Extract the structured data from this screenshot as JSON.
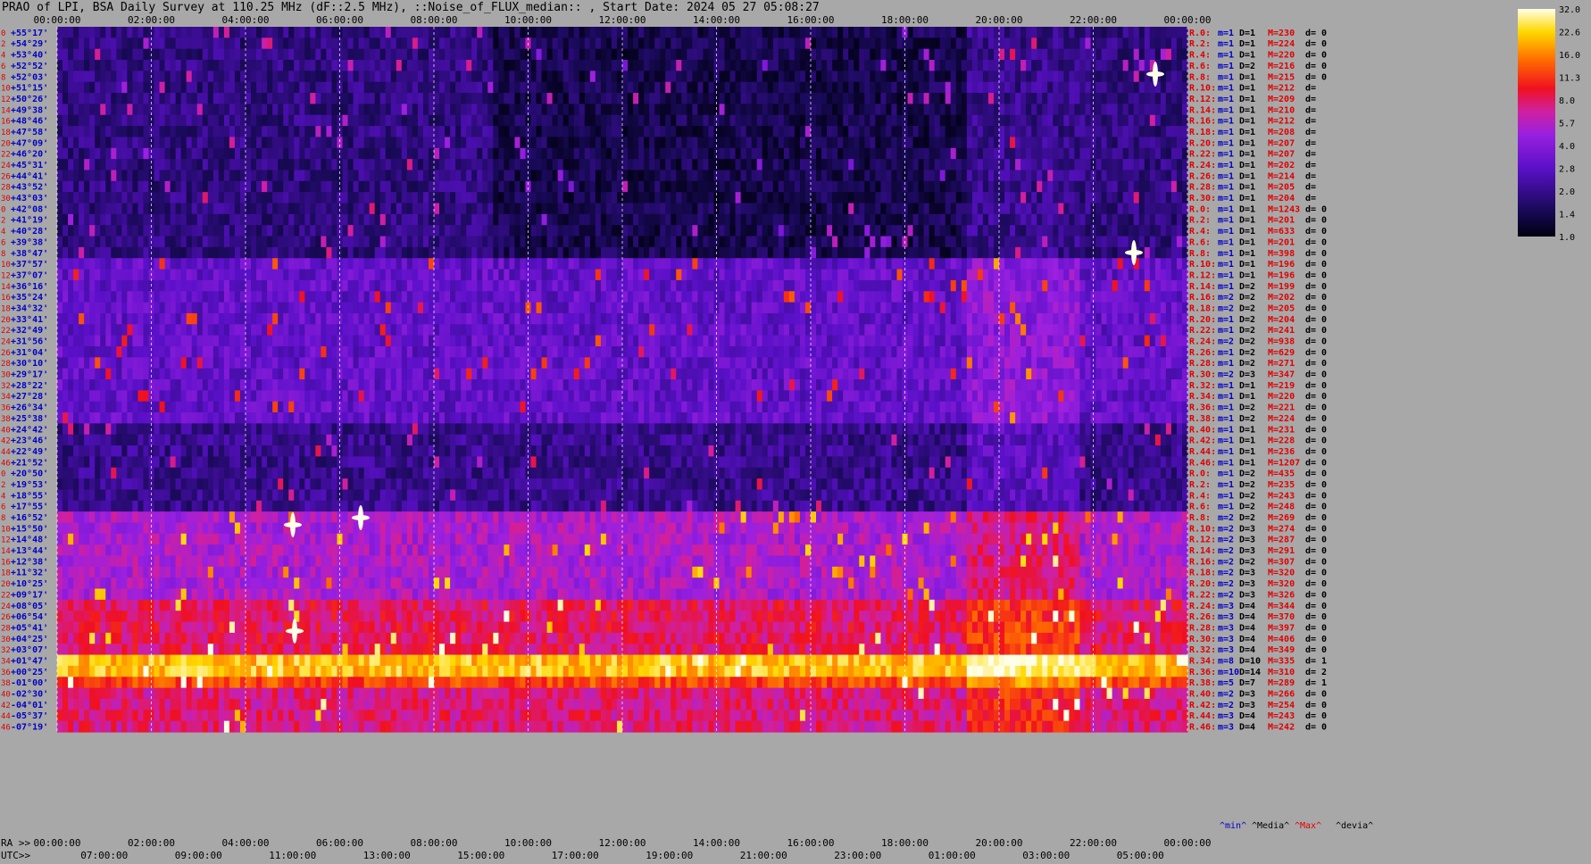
{
  "title": "PRAO of LPI, BSA Daily Survey at 110.25 MHz (dF::2.5 MHz), ::Noise_of_FLUX_median:: , Start Date: 2024 05 27 05:08:27",
  "chart_data": {
    "type": "heatmap",
    "title": "PRAO of LPI, BSA Daily Survey at 110.25 MHz (dF::2.5 MHz), ::Noise_of_FLUX_median:: , Start Date: 2024 05 27 05:08:27",
    "xaxis_ra_label": "RA >>",
    "xaxis_utc_label": "UTC>>",
    "ra_ticks": [
      "00:00:00",
      "02:00:00",
      "04:00:00",
      "06:00:00",
      "08:00:00",
      "10:00:00",
      "12:00:00",
      "14:00:00",
      "16:00:00",
      "18:00:00",
      "20:00:00",
      "22:00:00",
      "00:00:00"
    ],
    "utc_ticks": [
      "07:00:00",
      "09:00:00",
      "11:00:00",
      "13:00:00",
      "15:00:00",
      "17:00:00",
      "19:00:00",
      "21:00:00",
      "23:00:00",
      "01:00:00",
      "03:00:00",
      "05:00:00"
    ],
    "dec_labels": [
      "+55°17'",
      "+54°29'",
      "+53°40'",
      "+52°52'",
      "+52°03'",
      "+51°15'",
      "+50°26'",
      "+49°38'",
      "+48°46'",
      "+47°58'",
      "+47°09'",
      "+46°20'",
      "+45°31'",
      "+44°41'",
      "+43°52'",
      "+43°03'",
      "+42°08'",
      "+41°19'",
      "+40°28'",
      "+39°38'",
      "+38°47'",
      "+37°57'",
      "+37°07'",
      "+36°16'",
      "+35°24'",
      "+34°32'",
      "+33°41'",
      "+32°49'",
      "+31°56'",
      "+31°04'",
      "+30°10'",
      "+29°17'",
      "+28°22'",
      "+27°28'",
      "+26°34'",
      "+25°38'",
      "+24°42'",
      "+23°46'",
      "+22°49'",
      "+21°52'",
      "+20°50'",
      "+19°53'",
      "+18°55'",
      "+17°55'",
      "+16°52'",
      "+15°50'",
      "+14°48'",
      "+13°44'",
      "+12°38'",
      "+11°32'",
      "+10°25'",
      "+09°17'",
      "+08°05'",
      "+06°54'",
      "+05°41'",
      "+04°25'",
      "+03°07'",
      "+01°47'",
      "+00°25'",
      "-01°00'",
      "-02°30'",
      "-04°01'",
      "-05°37'",
      "-07°19'"
    ],
    "row_index_labels": [
      "0",
      "2",
      "4",
      "6",
      "8",
      "10",
      "12",
      "14",
      "16",
      "18",
      "20",
      "22",
      "24",
      "26",
      "28",
      "30",
      "0",
      "2",
      "4",
      "6",
      "8",
      "10",
      "12",
      "14",
      "16",
      "18",
      "20",
      "22",
      "24",
      "26",
      "28",
      "30",
      "32",
      "34",
      "36",
      "38",
      "40",
      "42",
      "44",
      "46",
      "0",
      "2",
      "4",
      "6",
      "8",
      "10",
      "12",
      "14",
      "16",
      "18",
      "20",
      "22",
      "24",
      "26",
      "28",
      "30",
      "32",
      "34",
      "36",
      "38",
      "40",
      "42",
      "44",
      "46"
    ],
    "stats_rows": [
      {
        "r": "R.0:",
        "m": "m=1",
        "d": "D=1",
        "M": "M=230",
        "dv": "d= 0"
      },
      {
        "r": "R.2:",
        "m": "m=1",
        "d": "D=1",
        "M": "M=224",
        "dv": "d= 0"
      },
      {
        "r": "R.4:",
        "m": "m=1",
        "d": "D=1",
        "M": "M=220",
        "dv": "d= 0"
      },
      {
        "r": "R.6:",
        "m": "m=1",
        "d": "D=2",
        "M": "M=216",
        "dv": "d= 0"
      },
      {
        "r": "R.8:",
        "m": "m=1",
        "d": "D=1",
        "M": "M=215",
        "dv": "d= 0"
      },
      {
        "r": "R.10:",
        "m": "m=1",
        "d": "D=1",
        "M": "M=212",
        "dv": "d="
      },
      {
        "r": "R.12:",
        "m": "m=1",
        "d": "D=1",
        "M": "M=209",
        "dv": "d="
      },
      {
        "r": "R.14:",
        "m": "m=1",
        "d": "D=1",
        "M": "M=210",
        "dv": "d="
      },
      {
        "r": "R.16:",
        "m": "m=1",
        "d": "D=1",
        "M": "M=212",
        "dv": "d="
      },
      {
        "r": "R.18:",
        "m": "m=1",
        "d": "D=1",
        "M": "M=208",
        "dv": "d="
      },
      {
        "r": "R.20:",
        "m": "m=1",
        "d": "D=1",
        "M": "M=207",
        "dv": "d="
      },
      {
        "r": "R.22:",
        "m": "m=1",
        "d": "D=1",
        "M": "M=207",
        "dv": "d="
      },
      {
        "r": "R.24:",
        "m": "m=1",
        "d": "D=1",
        "M": "M=202",
        "dv": "d="
      },
      {
        "r": "R.26:",
        "m": "m=1",
        "d": "D=1",
        "M": "M=214",
        "dv": "d="
      },
      {
        "r": "R.28:",
        "m": "m=1",
        "d": "D=1",
        "M": "M=205",
        "dv": "d="
      },
      {
        "r": "R.30:",
        "m": "m=1",
        "d": "D=1",
        "M": "M=204",
        "dv": "d="
      },
      {
        "r": "R.0:",
        "m": "m=1",
        "d": "D=1",
        "M": "M=1243",
        "dv": "d= 0"
      },
      {
        "r": "R.2:",
        "m": "m=1",
        "d": "D=1",
        "M": "M=201",
        "dv": "d= 0"
      },
      {
        "r": "R.4:",
        "m": "m=1",
        "d": "D=1",
        "M": "M=633",
        "dv": "d= 0"
      },
      {
        "r": "R.6:",
        "m": "m=1",
        "d": "D=1",
        "M": "M=201",
        "dv": "d= 0"
      },
      {
        "r": "R.8:",
        "m": "m=1",
        "d": "D=1",
        "M": "M=398",
        "dv": "d= 0"
      },
      {
        "r": "R.10:",
        "m": "m=1",
        "d": "D=1",
        "M": "M=196",
        "dv": "d= 0"
      },
      {
        "r": "R.12:",
        "m": "m=1",
        "d": "D=1",
        "M": "M=196",
        "dv": "d= 0"
      },
      {
        "r": "R.14:",
        "m": "m=1",
        "d": "D=2",
        "M": "M=199",
        "dv": "d= 0"
      },
      {
        "r": "R.16:",
        "m": "m=2",
        "d": "D=2",
        "M": "M=202",
        "dv": "d= 0"
      },
      {
        "r": "R.18:",
        "m": "m=2",
        "d": "D=2",
        "M": "M=205",
        "dv": "d= 0"
      },
      {
        "r": "R.20:",
        "m": "m=1",
        "d": "D=2",
        "M": "M=204",
        "dv": "d= 0"
      },
      {
        "r": "R.22:",
        "m": "m=1",
        "d": "D=2",
        "M": "M=241",
        "dv": "d= 0"
      },
      {
        "r": "R.24:",
        "m": "m=2",
        "d": "D=2",
        "M": "M=938",
        "dv": "d= 0"
      },
      {
        "r": "R.26:",
        "m": "m=1",
        "d": "D=2",
        "M": "M=629",
        "dv": "d= 0"
      },
      {
        "r": "R.28:",
        "m": "m=1",
        "d": "D=2",
        "M": "M=271",
        "dv": "d= 0"
      },
      {
        "r": "R.30:",
        "m": "m=2",
        "d": "D=3",
        "M": "M=347",
        "dv": "d= 0"
      },
      {
        "r": "R.32:",
        "m": "m=1",
        "d": "D=1",
        "M": "M=219",
        "dv": "d= 0"
      },
      {
        "r": "R.34:",
        "m": "m=1",
        "d": "D=1",
        "M": "M=220",
        "dv": "d= 0"
      },
      {
        "r": "R.36:",
        "m": "m=1",
        "d": "D=2",
        "M": "M=221",
        "dv": "d= 0"
      },
      {
        "r": "R.38:",
        "m": "m=1",
        "d": "D=2",
        "M": "M=224",
        "dv": "d= 0"
      },
      {
        "r": "R.40:",
        "m": "m=1",
        "d": "D=1",
        "M": "M=231",
        "dv": "d= 0"
      },
      {
        "r": "R.42:",
        "m": "m=1",
        "d": "D=1",
        "M": "M=228",
        "dv": "d= 0"
      },
      {
        "r": "R.44:",
        "m": "m=1",
        "d": "D=1",
        "M": "M=236",
        "dv": "d= 0"
      },
      {
        "r": "R.46:",
        "m": "m=1",
        "d": "D=1",
        "M": "M=1207",
        "dv": "d= 0"
      },
      {
        "r": "R.0:",
        "m": "m=1",
        "d": "D=2",
        "M": "M=435",
        "dv": "d= 0"
      },
      {
        "r": "R.2:",
        "m": "m=1",
        "d": "D=2",
        "M": "M=235",
        "dv": "d= 0"
      },
      {
        "r": "R.4:",
        "m": "m=1",
        "d": "D=2",
        "M": "M=243",
        "dv": "d= 0"
      },
      {
        "r": "R.6:",
        "m": "m=1",
        "d": "D=2",
        "M": "M=248",
        "dv": "d= 0"
      },
      {
        "r": "R.8:",
        "m": "m=2",
        "d": "D=2",
        "M": "M=269",
        "dv": "d= 0"
      },
      {
        "r": "R.10:",
        "m": "m=2",
        "d": "D=3",
        "M": "M=274",
        "dv": "d= 0"
      },
      {
        "r": "R.12:",
        "m": "m=2",
        "d": "D=3",
        "M": "M=287",
        "dv": "d= 0"
      },
      {
        "r": "R.14:",
        "m": "m=2",
        "d": "D=3",
        "M": "M=291",
        "dv": "d= 0"
      },
      {
        "r": "R.16:",
        "m": "m=2",
        "d": "D=2",
        "M": "M=307",
        "dv": "d= 0"
      },
      {
        "r": "R.18:",
        "m": "m=2",
        "d": "D=3",
        "M": "M=320",
        "dv": "d= 0"
      },
      {
        "r": "R.20:",
        "m": "m=2",
        "d": "D=3",
        "M": "M=320",
        "dv": "d= 0"
      },
      {
        "r": "R.22:",
        "m": "m=2",
        "d": "D=3",
        "M": "M=326",
        "dv": "d= 0"
      },
      {
        "r": "R.24:",
        "m": "m=3",
        "d": "D=4",
        "M": "M=344",
        "dv": "d= 0"
      },
      {
        "r": "R.26:",
        "m": "m=3",
        "d": "D=4",
        "M": "M=370",
        "dv": "d= 0"
      },
      {
        "r": "R.28:",
        "m": "m=3",
        "d": "D=4",
        "M": "M=397",
        "dv": "d= 0"
      },
      {
        "r": "R.30:",
        "m": "m=3",
        "d": "D=4",
        "M": "M=406",
        "dv": "d= 0"
      },
      {
        "r": "R.32:",
        "m": "m=3",
        "d": "D=4",
        "M": "M=349",
        "dv": "d= 0"
      },
      {
        "r": "R.34:",
        "m": "m=8",
        "d": "D=10",
        "M": "M=335",
        "dv": "d= 1"
      },
      {
        "r": "R.36:",
        "m": "m=10",
        "d": "D=14",
        "M": "M=310",
        "dv": "d= 2"
      },
      {
        "r": "R.38:",
        "m": "m=5",
        "d": "D=7",
        "M": "M=289",
        "dv": "d= 1"
      },
      {
        "r": "R.40:",
        "m": "m=2",
        "d": "D=3",
        "M": "M=266",
        "dv": "d= 0"
      },
      {
        "r": "R.42:",
        "m": "m=2",
        "d": "D=3",
        "M": "M=254",
        "dv": "d= 0"
      },
      {
        "r": "R.44:",
        "m": "m=3",
        "d": "D=4",
        "M": "M=243",
        "dv": "d= 0"
      },
      {
        "r": "R.46:",
        "m": "m=3",
        "d": "D=4",
        "M": "M=242",
        "dv": "d= 0"
      }
    ],
    "stats_footer": [
      "^min^",
      "^Media^",
      "^Max^",
      "^devia^"
    ],
    "colorbar_ticks": [
      "32.0",
      "22.6",
      "16.0",
      "11.3",
      "8.0",
      "5.7",
      "4.0",
      "2.8",
      "2.0",
      "1.4",
      "1.0"
    ],
    "colors": {
      "bg": "#a8a8a8",
      "label_blue": "#0000c8",
      "label_red": "#e00000",
      "text": "#000000"
    }
  }
}
